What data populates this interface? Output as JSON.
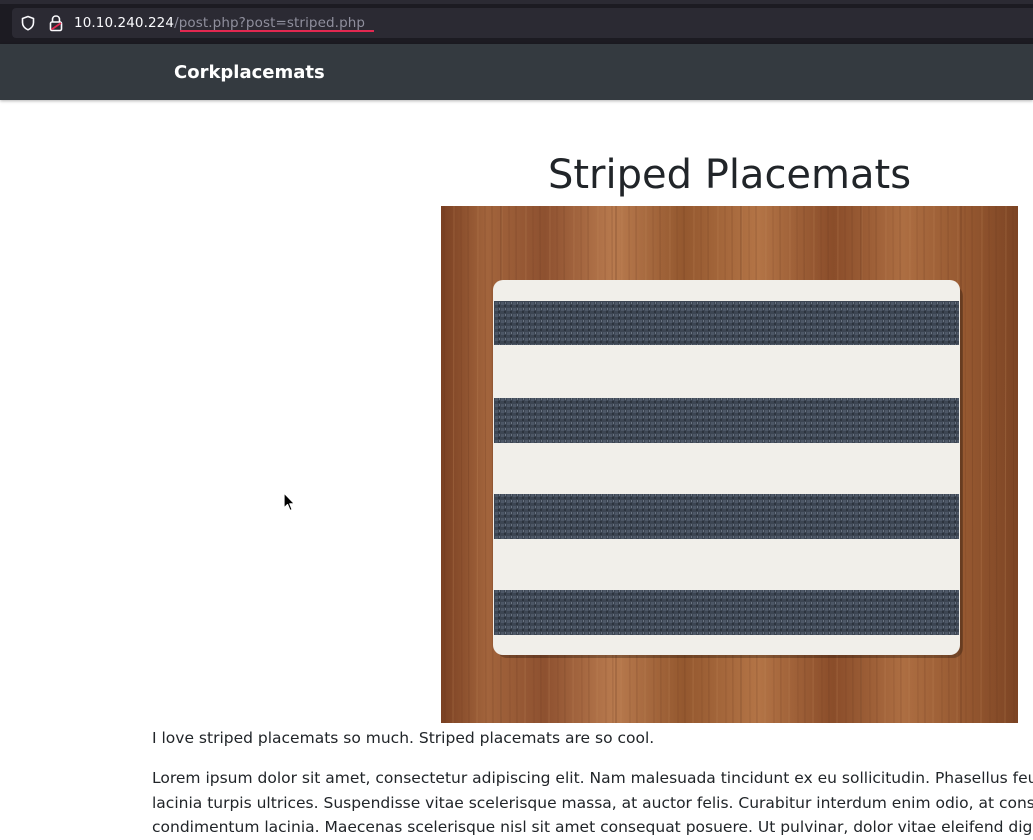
{
  "browser": {
    "url_host": "10.10.240.224",
    "url_path": "/post.php?post=striped.php",
    "icons": [
      "shield-icon",
      "lock-icon"
    ],
    "accent_color": "#e22850"
  },
  "navbar": {
    "brand": "Corkplacemats",
    "background": "#343a40"
  },
  "post": {
    "title": "Striped Placemats",
    "image_alt": "striped placemat on wooden table",
    "intro": "I love striped placemats so much. Striped placemats are so cool.",
    "body_lines": [
      "Lorem ipsum dolor sit amet, consectetur adipiscing elit. Nam malesuada tincidunt ex eu sollicitudin. Phasellus feugiat",
      "lacinia turpis ultrices. Suspendisse vitae scelerisque massa, at auctor felis. Curabitur interdum enim odio, at consectet",
      "condimentum lacinia. Maecenas scelerisque nisl sit amet consequat posuere. Ut pulvinar, dolor vitae eleifend dignissi"
    ]
  }
}
